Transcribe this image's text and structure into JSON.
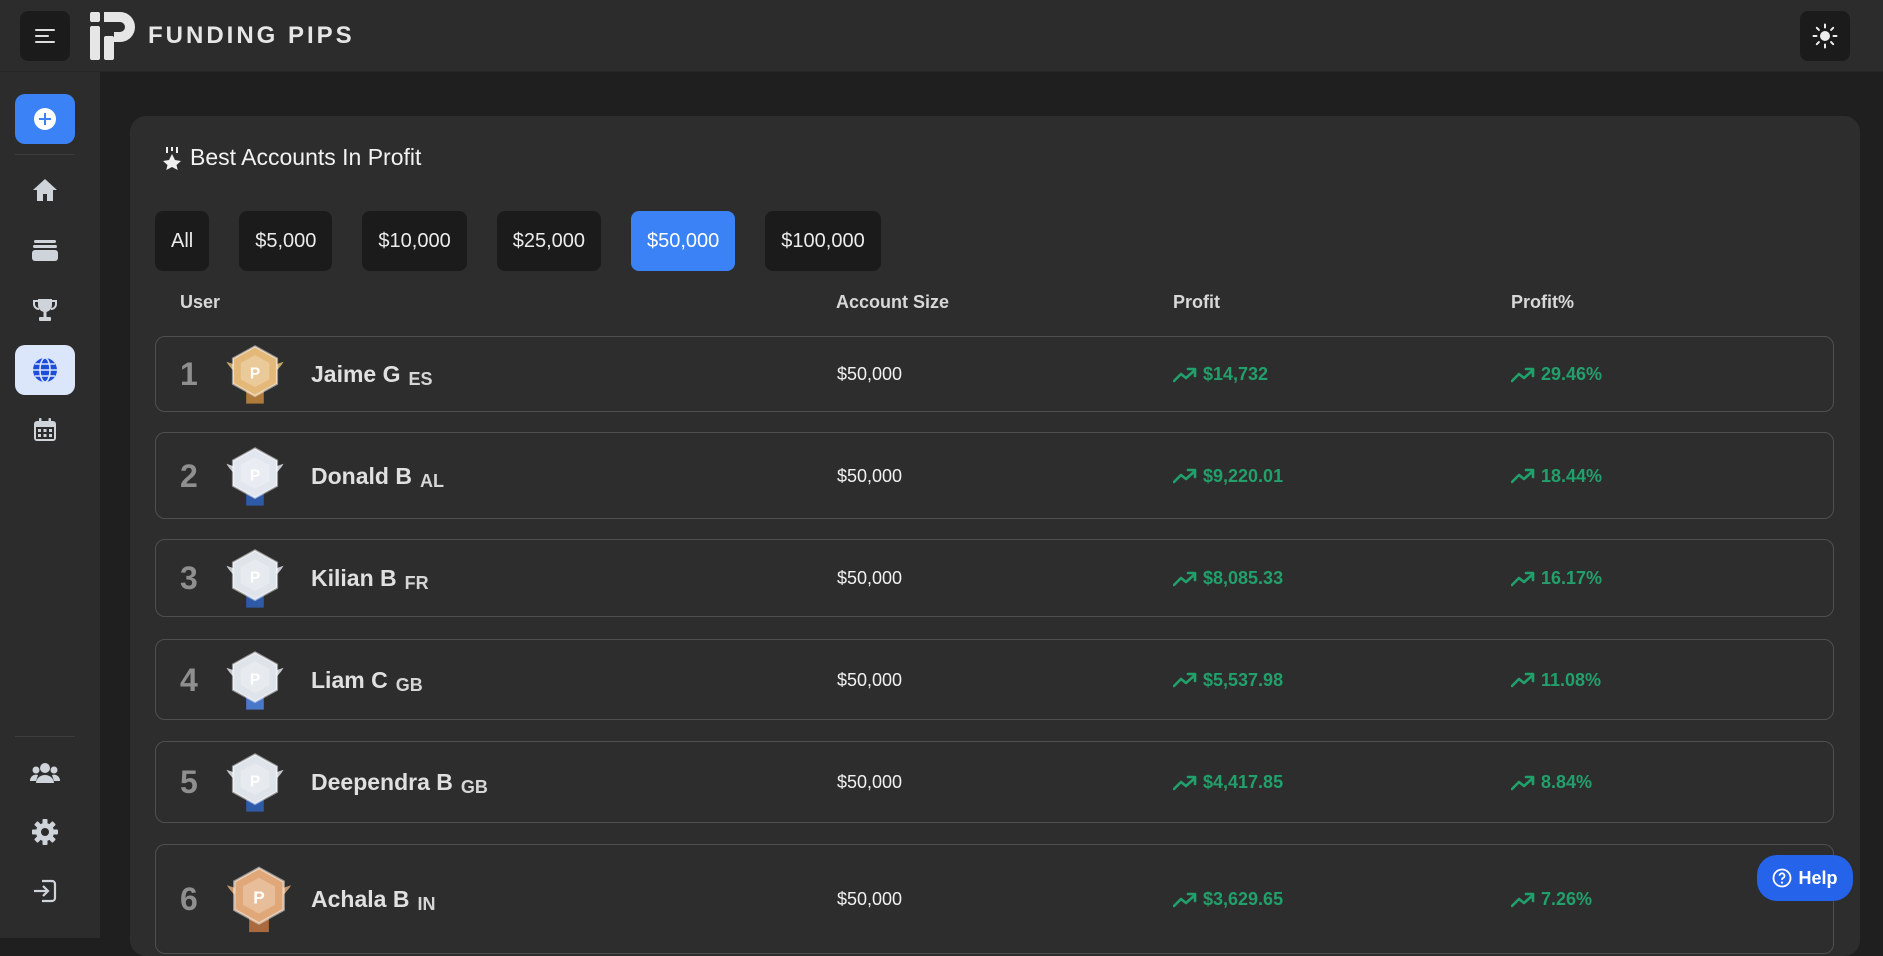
{
  "app": {
    "brand": "FUNDING PIPS"
  },
  "sidebar": {
    "items": [
      "add",
      "home",
      "wallet",
      "trophy",
      "globe",
      "calendar",
      "users",
      "settings",
      "logout"
    ],
    "active": "globe"
  },
  "leaderboard": {
    "title": "Best Accounts In Profit",
    "filters": [
      "All",
      "$5,000",
      "$10,000",
      "$25,000",
      "$50,000",
      "$100,000"
    ],
    "active_filter": "$50,000",
    "columns": [
      "User",
      "Account Size",
      "Profit",
      "Profit%"
    ],
    "rows": [
      {
        "rank": "1",
        "name": "Jaime G",
        "country": "ES",
        "account_size": "$50,000",
        "profit": "$14,732",
        "profit_pct": "29.46%"
      },
      {
        "rank": "2",
        "name": "Donald B",
        "country": "AL",
        "account_size": "$50,000",
        "profit": "$9,220.01",
        "profit_pct": "18.44%"
      },
      {
        "rank": "3",
        "name": "Kilian B",
        "country": "FR",
        "account_size": "$50,000",
        "profit": "$8,085.33",
        "profit_pct": "16.17%"
      },
      {
        "rank": "4",
        "name": "Liam C",
        "country": "GB",
        "account_size": "$50,000",
        "profit": "$5,537.98",
        "profit_pct": "11.08%"
      },
      {
        "rank": "5",
        "name": "Deependra B",
        "country": "GB",
        "account_size": "$50,000",
        "profit": "$4,417.85",
        "profit_pct": "8.84%"
      },
      {
        "rank": "6",
        "name": "Achala B",
        "country": "IN",
        "account_size": "$50,000",
        "profit": "$3,629.65",
        "profit_pct": "7.26%"
      }
    ]
  },
  "help": {
    "label": "Help"
  },
  "colors": {
    "accent": "#3b82f6",
    "gain": "#22a06b",
    "active_sidebar": "#dbe6fb"
  }
}
